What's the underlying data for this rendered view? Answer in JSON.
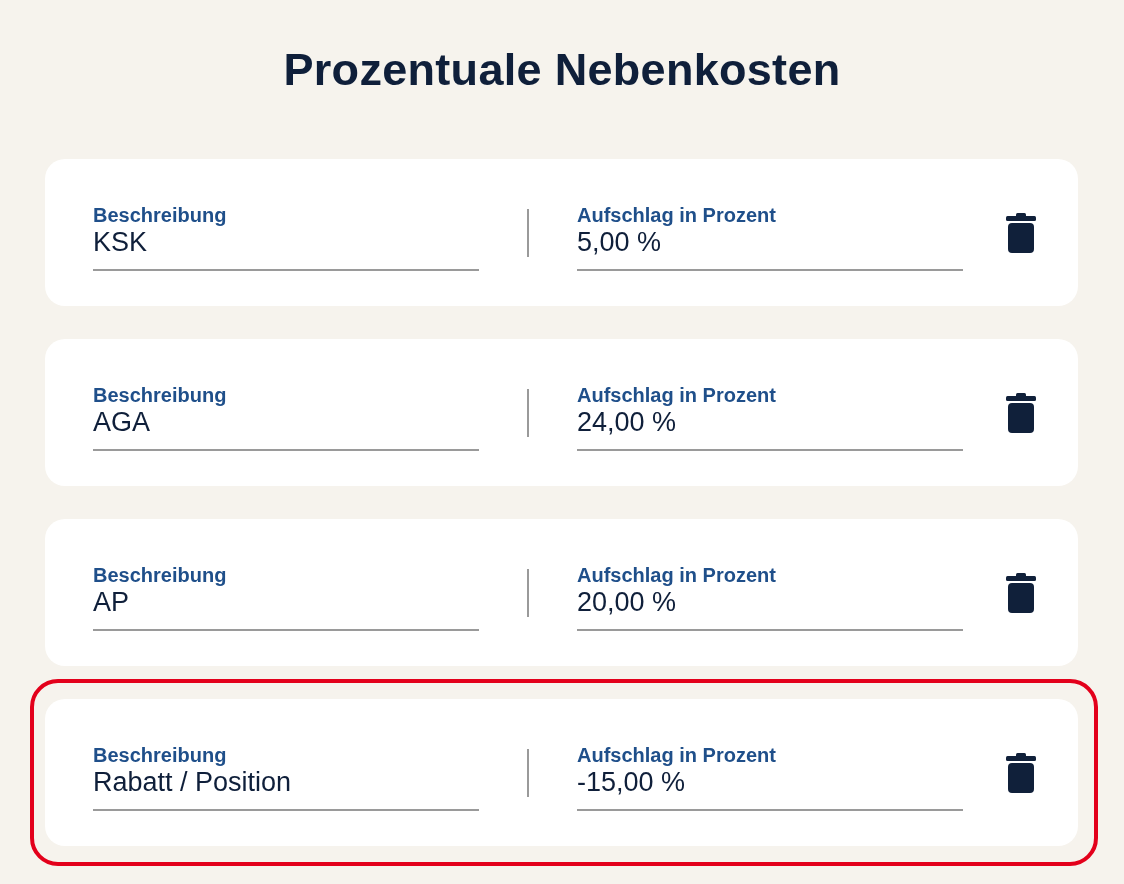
{
  "title": "Prozentuale Nebenkosten",
  "rows": [
    {
      "description_label": "Beschreibung",
      "description": "KSK",
      "percent_label": "Aufschlag in Prozent",
      "percent": "5,00 %",
      "highlighted": false
    },
    {
      "description_label": "Beschreibung",
      "description": "AGA",
      "percent_label": "Aufschlag in Prozent",
      "percent": "24,00 %",
      "highlighted": false
    },
    {
      "description_label": "Beschreibung",
      "description": "AP",
      "percent_label": "Aufschlag in Prozent",
      "percent": "20,00 %",
      "highlighted": false
    },
    {
      "description_label": "Beschreibung",
      "description": "Rabatt / Position",
      "percent_label": "Aufschlag in Prozent",
      "percent": "-15,00 %",
      "highlighted": true
    }
  ]
}
